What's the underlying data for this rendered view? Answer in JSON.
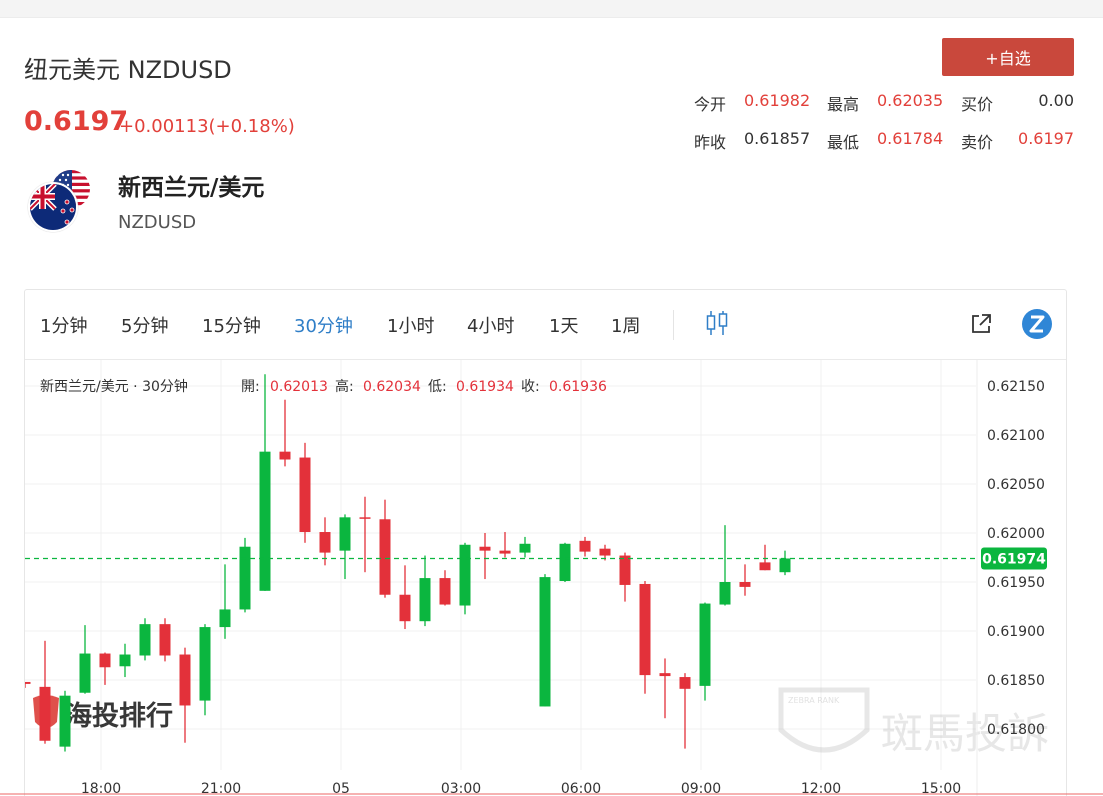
{
  "header": {
    "title": "纽元美元 NZDUSD",
    "price": "0.6197",
    "change": "+0.00113(+0.18%)",
    "add_watchlist": "+自选"
  },
  "stats": {
    "open_label": "今开",
    "open": "0.61982",
    "high_label": "最高",
    "high": "0.62035",
    "bid_label": "买价",
    "bid": "0.00",
    "prev_label": "昨收",
    "prev": "0.61857",
    "low_label": "最低",
    "low": "0.61784",
    "ask_label": "卖价",
    "ask": "0.6197"
  },
  "instrument": {
    "name_cn": "新西兰元/美元",
    "code": "NZDUSD"
  },
  "toolbar": {
    "timeframes": [
      "1分钟",
      "5分钟",
      "15分钟",
      "30分钟",
      "1小时",
      "4小时",
      "1天",
      "1周"
    ],
    "active": "30分钟",
    "icons": [
      "candlestick-icon",
      "popout-icon",
      "tradingview-icon"
    ]
  },
  "legend": {
    "title": "新西兰元/美元 · 30分钟",
    "open_label": "開:",
    "open": "0.62013",
    "high_label": "高:",
    "high": "0.62034",
    "low_label": "低:",
    "low": "0.61934",
    "close_label": "收:",
    "close": "0.61936"
  },
  "watermarks": {
    "left": "海投排行",
    "right": "斑馬投訴",
    "badge": "ZEBRA RANK"
  },
  "colors": {
    "up": "#0bb63f",
    "down": "#e3313a",
    "accent": "#2f7ec7",
    "price_red": "#e2403a",
    "button": "#c9483c"
  },
  "chart_data": {
    "type": "candlestick",
    "y_ticks": [
      "0.62150",
      "0.62100",
      "0.62050",
      "0.62000",
      "0.61950",
      "0.61900",
      "0.61850",
      "0.61800"
    ],
    "ylim": [
      0.6177,
      0.6216
    ],
    "x_ticks": [
      "18:00",
      "21:00",
      "05",
      "03:00",
      "06:00",
      "09:00",
      "12:00",
      "15:00"
    ],
    "last_price_label": "0.61974",
    "last_price": 0.61974,
    "candles": [
      {
        "o": 0.61848,
        "h": 0.61848,
        "l": 0.61842,
        "c": 0.61846
      },
      {
        "o": 0.61843,
        "h": 0.6189,
        "l": 0.61785,
        "c": 0.61788
      },
      {
        "o": 0.61782,
        "h": 0.61839,
        "l": 0.61777,
        "c": 0.61834
      },
      {
        "o": 0.61837,
        "h": 0.61906,
        "l": 0.61836,
        "c": 0.61877
      },
      {
        "o": 0.61877,
        "h": 0.61878,
        "l": 0.61845,
        "c": 0.61863
      },
      {
        "o": 0.61864,
        "h": 0.61887,
        "l": 0.61853,
        "c": 0.61876
      },
      {
        "o": 0.61875,
        "h": 0.61913,
        "l": 0.6187,
        "c": 0.61907
      },
      {
        "o": 0.61907,
        "h": 0.61913,
        "l": 0.61869,
        "c": 0.61875
      },
      {
        "o": 0.61876,
        "h": 0.61883,
        "l": 0.61786,
        "c": 0.61824
      },
      {
        "o": 0.61829,
        "h": 0.61907,
        "l": 0.61814,
        "c": 0.61904
      },
      {
        "o": 0.61904,
        "h": 0.61968,
        "l": 0.61892,
        "c": 0.61922
      },
      {
        "o": 0.61922,
        "h": 0.61995,
        "l": 0.61919,
        "c": 0.61986
      },
      {
        "o": 0.61941,
        "h": 0.62162,
        "l": 0.61941,
        "c": 0.62083
      },
      {
        "o": 0.62083,
        "h": 0.62136,
        "l": 0.62068,
        "c": 0.62075
      },
      {
        "o": 0.62077,
        "h": 0.62092,
        "l": 0.6199,
        "c": 0.62001
      },
      {
        "o": 0.62001,
        "h": 0.62016,
        "l": 0.61967,
        "c": 0.6198
      },
      {
        "o": 0.61982,
        "h": 0.62019,
        "l": 0.61953,
        "c": 0.62016
      },
      {
        "o": 0.62016,
        "h": 0.62037,
        "l": 0.6196,
        "c": 0.62015
      },
      {
        "o": 0.62014,
        "h": 0.62034,
        "l": 0.61934,
        "c": 0.61937
      },
      {
        "o": 0.61937,
        "h": 0.61967,
        "l": 0.61902,
        "c": 0.6191
      },
      {
        "o": 0.6191,
        "h": 0.61977,
        "l": 0.61905,
        "c": 0.61954
      },
      {
        "o": 0.61954,
        "h": 0.61962,
        "l": 0.61926,
        "c": 0.61927
      },
      {
        "o": 0.61926,
        "h": 0.6199,
        "l": 0.61917,
        "c": 0.61988
      },
      {
        "o": 0.61986,
        "h": 0.62,
        "l": 0.61953,
        "c": 0.61982
      },
      {
        "o": 0.61982,
        "h": 0.62001,
        "l": 0.61975,
        "c": 0.61979
      },
      {
        "o": 0.6198,
        "h": 0.61996,
        "l": 0.61975,
        "c": 0.61989
      },
      {
        "o": 0.61823,
        "h": 0.61958,
        "l": 0.61823,
        "c": 0.61955
      },
      {
        "o": 0.61951,
        "h": 0.6199,
        "l": 0.6195,
        "c": 0.61989
      },
      {
        "o": 0.61992,
        "h": 0.61996,
        "l": 0.61976,
        "c": 0.61981
      },
      {
        "o": 0.61984,
        "h": 0.61988,
        "l": 0.61972,
        "c": 0.61977
      },
      {
        "o": 0.61977,
        "h": 0.6198,
        "l": 0.6193,
        "c": 0.61947
      },
      {
        "o": 0.61948,
        "h": 0.61951,
        "l": 0.61836,
        "c": 0.61855
      },
      {
        "o": 0.61857,
        "h": 0.61872,
        "l": 0.61811,
        "c": 0.61854
      },
      {
        "o": 0.61853,
        "h": 0.61857,
        "l": 0.6178,
        "c": 0.61841
      },
      {
        "o": 0.61844,
        "h": 0.61929,
        "l": 0.61829,
        "c": 0.61928
      },
      {
        "o": 0.61927,
        "h": 0.62008,
        "l": 0.61926,
        "c": 0.6195
      },
      {
        "o": 0.6195,
        "h": 0.61968,
        "l": 0.61936,
        "c": 0.61945
      },
      {
        "o": 0.6197,
        "h": 0.61988,
        "l": 0.61962,
        "c": 0.61962
      },
      {
        "o": 0.6196,
        "h": 0.61982,
        "l": 0.61957,
        "c": 0.61974
      }
    ]
  }
}
